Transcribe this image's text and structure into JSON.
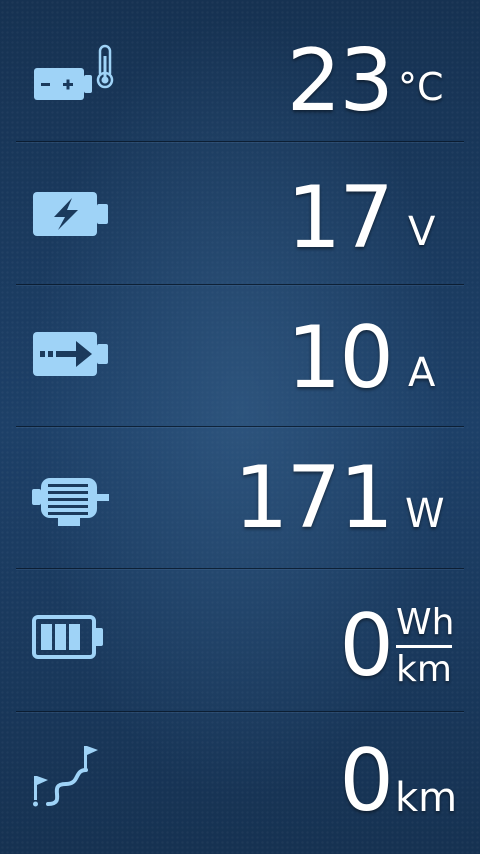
{
  "theme": {
    "icon_color": "#9fd3f7",
    "text_color": "#ffffff",
    "background": "#1b3a5c"
  },
  "metrics": [
    {
      "icon": "battery-temperature-icon",
      "value": "23",
      "unit": "°C"
    },
    {
      "icon": "battery-voltage-icon",
      "value": "17",
      "unit": "V"
    },
    {
      "icon": "battery-current-icon",
      "value": "10",
      "unit": "A"
    },
    {
      "icon": "motor-power-icon",
      "value": "171",
      "unit": "W"
    },
    {
      "icon": "battery-consumption-icon",
      "value": "0",
      "unit_numerator": "Wh",
      "unit_denominator": "km"
    },
    {
      "icon": "route-distance-icon",
      "value": "0",
      "unit": "km"
    }
  ]
}
